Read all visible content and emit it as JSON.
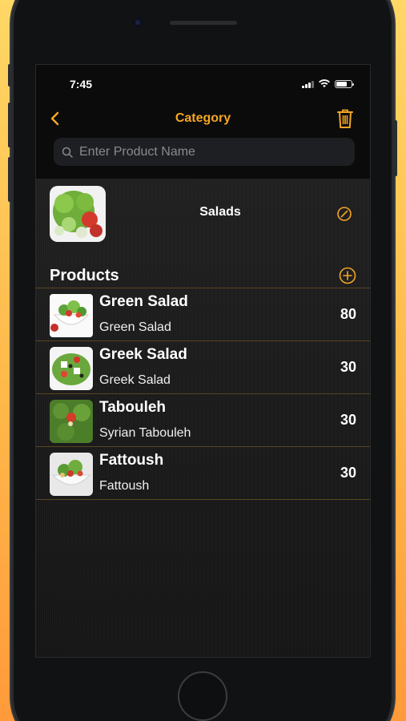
{
  "status_bar": {
    "time": "7:45",
    "battery_level": 0.7
  },
  "nav": {
    "title": "Category",
    "back_icon": "chevron-left-icon",
    "trash_icon": "trash-icon"
  },
  "search": {
    "placeholder": "Enter Product Name",
    "value": ""
  },
  "category": {
    "name": "Salads"
  },
  "products": {
    "header": "Products",
    "items": [
      {
        "name": "Green Salad",
        "subtitle": "Green Salad",
        "qty": "80"
      },
      {
        "name": "Greek Salad",
        "subtitle": "Greek Salad",
        "qty": "30"
      },
      {
        "name": "Tabouleh",
        "subtitle": "Syrian Tabouleh",
        "qty": "30"
      },
      {
        "name": "Fattoush",
        "subtitle": "Fattoush",
        "qty": "30"
      }
    ]
  },
  "colors": {
    "accent": "#f5a623",
    "divider": "#5a4520",
    "background": "#1a1a1a"
  }
}
